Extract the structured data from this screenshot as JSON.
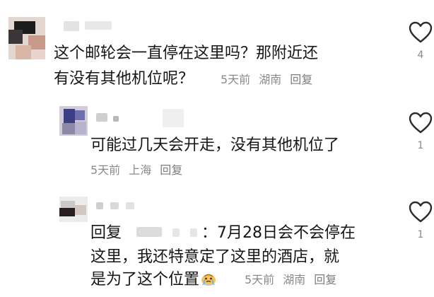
{
  "comments": [
    {
      "text_lines": [
        "这个邮轮会一直停在这里吗？那附近还",
        "有没有其他机位呢？"
      ],
      "time": "5天前",
      "location": "湖南",
      "reply_label": "回复",
      "likes": "4",
      "like_icon": "heart-outline-icon"
    },
    {
      "text_lines": [
        "可能过几天会开走，没有其他机位了"
      ],
      "time": "5天前",
      "location": "上海",
      "reply_label": "回复",
      "likes": "1",
      "like_icon": "heart-outline-icon"
    },
    {
      "reply_prefix": "回复",
      "reply_colon": "：",
      "text_lines": [
        "7月28日会不会停在",
        "这里，我还特意定了这里的酒店，就",
        "是为了这个位置"
      ],
      "emoji": "crying-face-emoji",
      "time": "5天前",
      "location": "湖南",
      "reply_label": "回复",
      "likes": "1",
      "like_icon": "heart-outline-icon"
    }
  ],
  "colors": {
    "text": "#161616",
    "meta": "#8a8a8a",
    "icon": "#2b2b2b",
    "blur": "#d6d6d6"
  }
}
